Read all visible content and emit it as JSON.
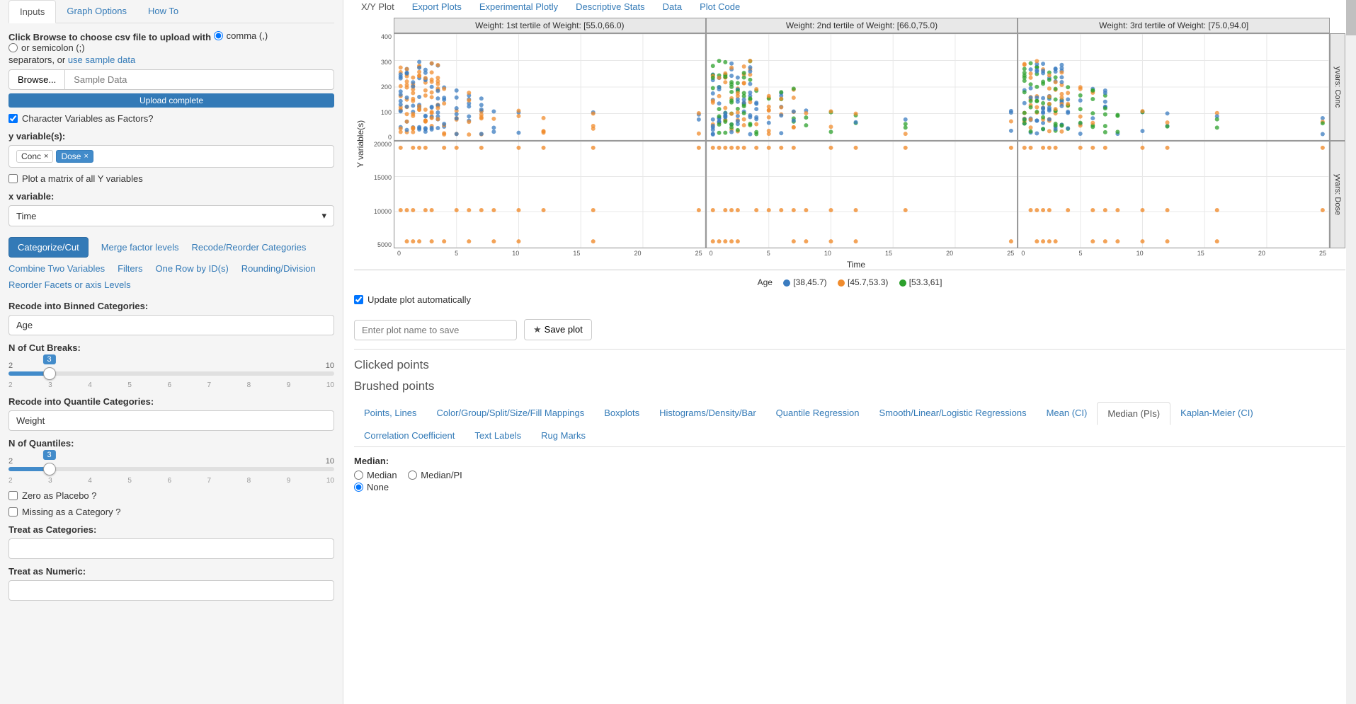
{
  "sidebar": {
    "tabs": [
      "Inputs",
      "Graph Options",
      "How To"
    ],
    "browse_label_1": "Click Browse to choose csv file to upload with ",
    "sep_comma": "comma (,)",
    "sep_semi": "or semicolon (;)",
    "browse_label_2": "separators, or ",
    "sample_link": "use sample data",
    "browse_btn": "Browse...",
    "sample_btn": "Sample Data",
    "upload_status": "Upload complete",
    "char_factors": "Character Variables as Factors?",
    "yvar_label": "y variable(s):",
    "yvar_tags": [
      "Conc",
      "Dose"
    ],
    "plot_matrix": "Plot a matrix of all Y variables",
    "xvar_label": "x variable:",
    "xvar_value": "Time",
    "actions": [
      "Categorize/Cut",
      "Merge factor levels",
      "Recode/Reorder Categories",
      "Combine Two Variables",
      "Filters",
      "One Row by ID(s)",
      "Rounding/Division",
      "Reorder Facets or axis Levels"
    ],
    "recode_binned_label": "Recode into Binned Categories:",
    "recode_binned_value": "Age",
    "n_cut_breaks_label": "N of Cut Breaks:",
    "slider1": {
      "min": "2",
      "max": "10",
      "value": "3",
      "ticks": [
        "2",
        "3",
        "4",
        "5",
        "6",
        "7",
        "8",
        "9",
        "10"
      ]
    },
    "recode_quantile_label": "Recode into Quantile Categories:",
    "recode_quantile_value": "Weight",
    "n_quantiles_label": "N of Quantiles:",
    "slider2": {
      "min": "2",
      "max": "10",
      "value": "3",
      "ticks": [
        "2",
        "3",
        "4",
        "5",
        "6",
        "7",
        "8",
        "9",
        "10"
      ]
    },
    "zero_placebo": "Zero as Placebo ?",
    "missing_cat": "Missing as a Category ?",
    "treat_cat_label": "Treat as Categories:",
    "treat_num_label": "Treat as Numeric:"
  },
  "main": {
    "top_tabs": [
      "X/Y Plot",
      "Export Plots",
      "Experimental Plotly",
      "Descriptive Stats",
      "Data",
      "Plot Code"
    ],
    "facet_col_headers": [
      "Weight: 1st tertile of Weight: [55.0,66.0)",
      "Weight: 2nd tertile of Weight: [66.0,75.0)",
      "Weight: 3rd tertile of Weight: [75.0,94.0]"
    ],
    "facet_row_headers": [
      "yvars: Conc",
      "yvars: Dose"
    ],
    "y_ticks_top": [
      "400",
      "300",
      "200",
      "100",
      "0"
    ],
    "y_ticks_bot": [
      "20000",
      "15000",
      "10000",
      "5000"
    ],
    "x_ticks": [
      "0",
      "5",
      "10",
      "15",
      "20",
      "25"
    ],
    "x_label": "Time",
    "y_label": "Y variable(s)",
    "legend_title": "Age",
    "legend_items": [
      {
        "color": "#3b7cc0",
        "label": "[38,45.7)"
      },
      {
        "color": "#f08c2e",
        "label": "[45.7,53.3)"
      },
      {
        "color": "#2ca02c",
        "label": "[53.3,61]"
      }
    ],
    "update_auto": "Update plot automatically",
    "save_placeholder": "Enter plot name to save",
    "save_btn": "Save plot",
    "clicked_points": "Clicked points",
    "brushed_points": "Brushed points",
    "sub_tabs_row1": [
      "Points, Lines",
      "Color/Group/Split/Size/Fill Mappings",
      "Boxplots",
      "Histograms/Density/Bar",
      "Quantile Regression",
      "Smooth/Linear/Logistic Regressions",
      "Mean (CI)"
    ],
    "sub_tabs_row2": [
      "Median (PIs)",
      "Kaplan-Meier (CI)",
      "Correlation Coefficient",
      "Text Labels",
      "Rug Marks"
    ],
    "median_label": "Median:",
    "median_opts": [
      "Median",
      "Median/PI",
      "None"
    ]
  },
  "chart_data": {
    "type": "scatter",
    "facets": {
      "cols": [
        "Weight: [55.0,66.0)",
        "Weight: [66.0,75.0)",
        "Weight: [75.0,94.0]"
      ],
      "rows": [
        "Conc",
        "Dose"
      ]
    },
    "color_by": "Age",
    "color_levels": [
      "[38,45.7)",
      "[45.7,53.3)",
      "[53.3,61]"
    ],
    "x": "Time",
    "x_range": [
      0,
      25
    ],
    "y_ranges": {
      "Conc": [
        0,
        400
      ],
      "Dose": [
        5000,
        20000
      ]
    },
    "note": "Scatter points estimated from pixels; top row shows Conc vs Time (dense cluster 0-7, sparse to 25, values 0-350), bottom row shows Dose values clustered near 5000, 10000, 20000 across Time."
  }
}
